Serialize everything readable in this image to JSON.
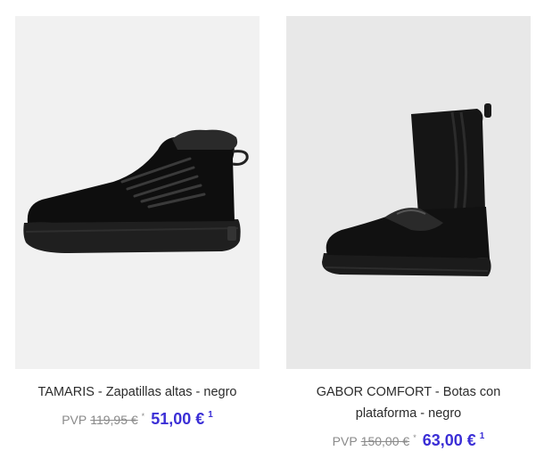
{
  "products": [
    {
      "title": "TAMARIS - Zapatillas altas - negro",
      "pvp_label": "PVP",
      "old_price": "119,95 €",
      "asterisk": "*",
      "new_price": "51,00 €",
      "footnote": "1"
    },
    {
      "title": "GABOR COMFORT - Botas con plataforma - negro",
      "pvp_label": "PVP",
      "old_price": "150,00 €",
      "asterisk": "*",
      "new_price": "63,00 €",
      "footnote": "1"
    }
  ],
  "colors": {
    "price_accent": "#3b2fd6"
  }
}
